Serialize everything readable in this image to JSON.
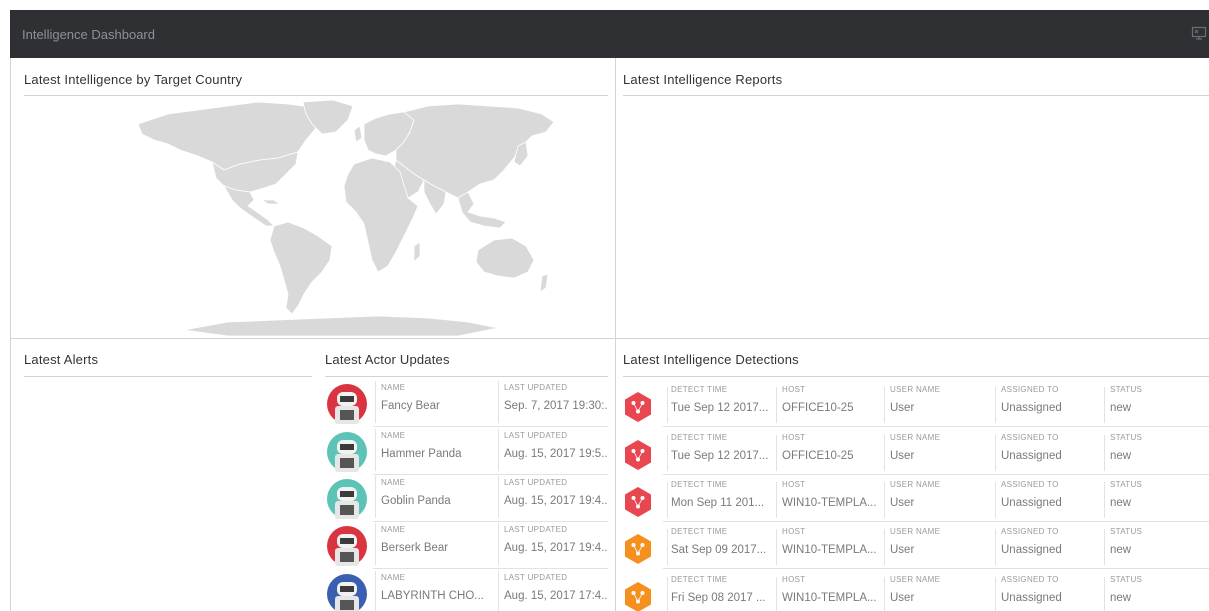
{
  "header": {
    "title": "Intelligence Dashboard",
    "icon": "monitor-icon"
  },
  "panels": {
    "map_title": "Latest Intelligence by Target Country",
    "reports_title": "Latest Intelligence Reports",
    "alerts_title": "Latest Alerts",
    "actors_title": "Latest Actor Updates",
    "detections_title": "Latest Intelligence Detections"
  },
  "actors": {
    "col_name": "NAME",
    "col_updated": "LAST UPDATED",
    "items": [
      {
        "name": "Fancy Bear",
        "updated": "Sep. 7, 2017 19:30:...",
        "avatar_color": "#d9343f",
        "avatar": "bear-avatar"
      },
      {
        "name": "Hammer Panda",
        "updated": "Aug. 15, 2017 19:5...",
        "avatar_color": "#5cc3b6",
        "avatar": "panda-avatar"
      },
      {
        "name": "Goblin Panda",
        "updated": "Aug. 15, 2017 19:4...",
        "avatar_color": "#5cc3b6",
        "avatar": "panda-avatar"
      },
      {
        "name": "Berserk Bear",
        "updated": "Aug. 15, 2017 19:4...",
        "avatar_color": "#d9343f",
        "avatar": "bear-avatar"
      },
      {
        "name": "LABYRINTH CHO...",
        "updated": "Aug. 15, 2017 17:4...",
        "avatar_color": "#3a5fb0",
        "avatar": "chollima-avatar"
      }
    ]
  },
  "detections": {
    "col_time": "DETECT TIME",
    "col_host": "HOST",
    "col_user": "USER NAME",
    "col_assigned": "ASSIGNED TO",
    "col_status": "STATUS",
    "items": [
      {
        "time": "Tue Sep 12 2017...",
        "host": "OFFICE10-25",
        "user": "User",
        "assigned": "Unassigned",
        "status": "new",
        "color": "#e8474f"
      },
      {
        "time": "Tue Sep 12 2017...",
        "host": "OFFICE10-25",
        "user": "User",
        "assigned": "Unassigned",
        "status": "new",
        "color": "#e8474f"
      },
      {
        "time": "Mon Sep 11 201...",
        "host": "WIN10-TEMPLA...",
        "user": "User",
        "assigned": "Unassigned",
        "status": "new",
        "color": "#e8474f"
      },
      {
        "time": "Sat Sep 09 2017...",
        "host": "WIN10-TEMPLA...",
        "user": "User",
        "assigned": "Unassigned",
        "status": "new",
        "color": "#f5901e"
      },
      {
        "time": "Fri Sep 08 2017 ...",
        "host": "WIN10-TEMPLA...",
        "user": "User",
        "assigned": "Unassigned",
        "status": "new",
        "color": "#f5901e"
      }
    ]
  },
  "colors": {
    "header_bg": "#2e3033",
    "map_fill": "#d9d9d9",
    "critical": "#e8474f",
    "high": "#f5901e"
  }
}
